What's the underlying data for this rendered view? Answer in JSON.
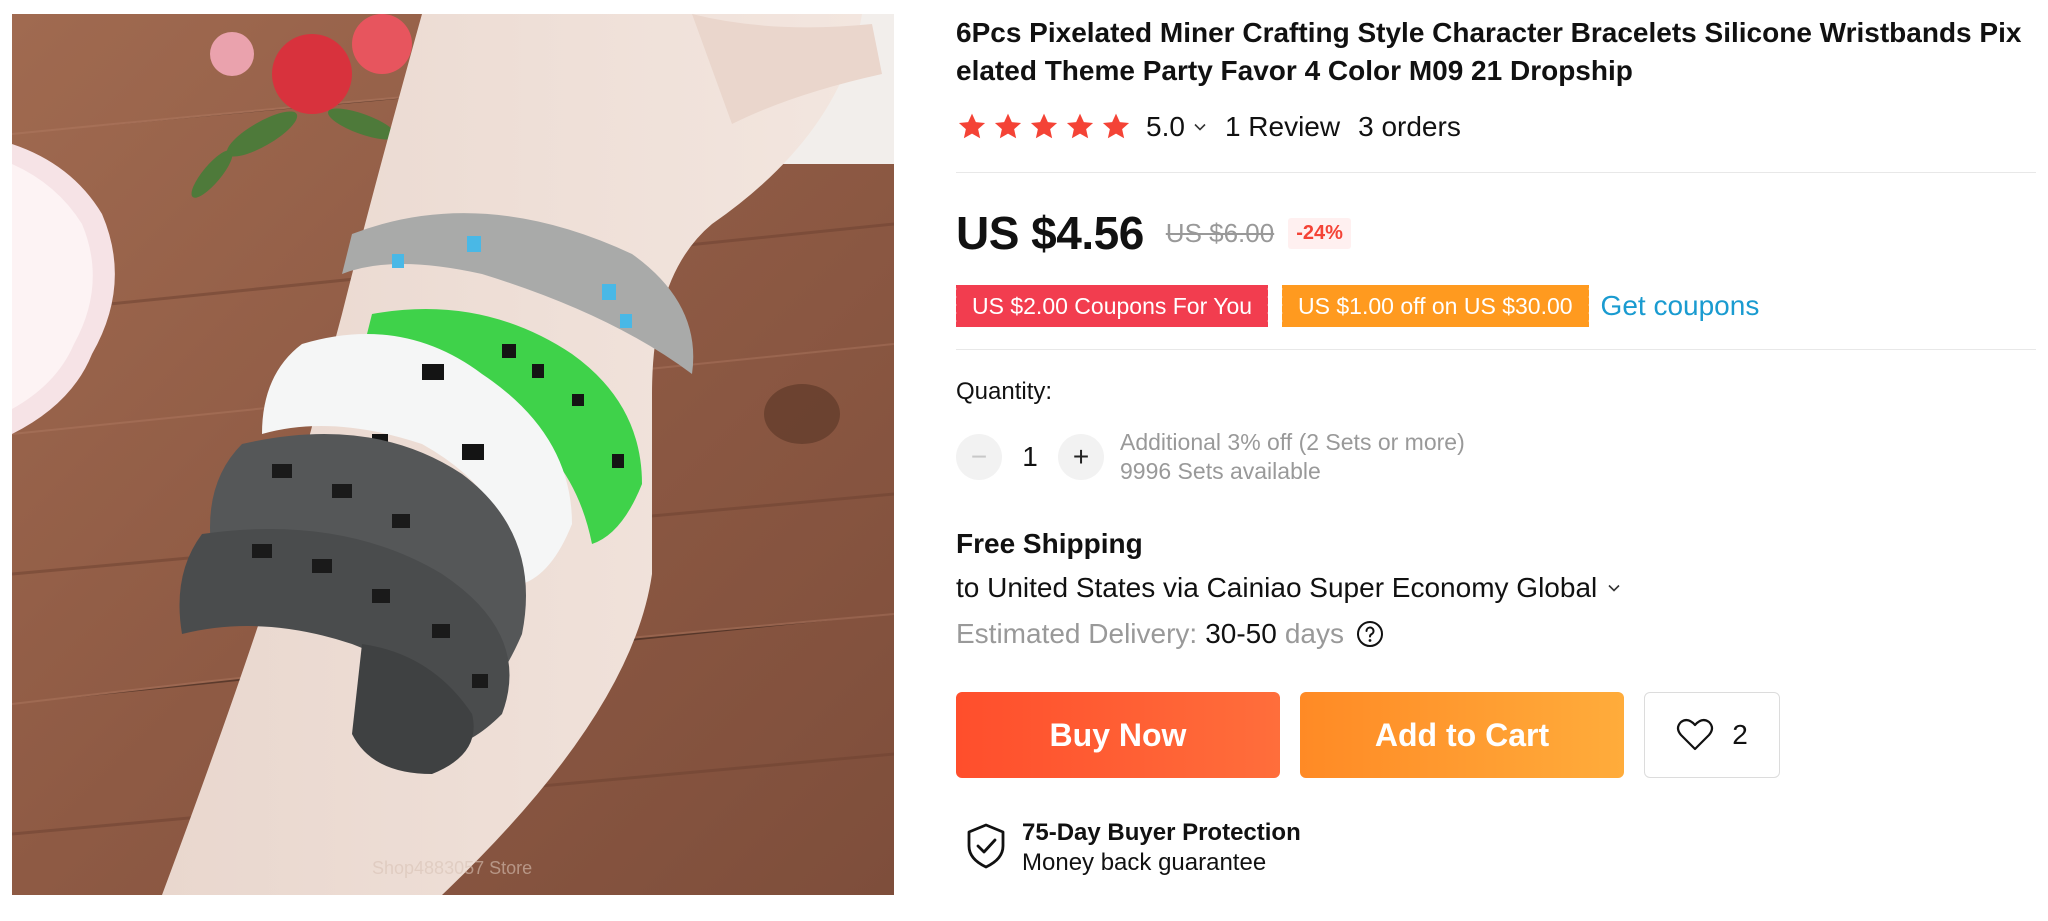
{
  "product": {
    "title": "6Pcs Pixelated Miner Crafting Style Character Bracelets Silicone Wristbands Pixelated Theme Party Favor 4 Color M09 21 Dropship",
    "image_alt": "bracelets-photo",
    "watermark": "Shop4883057 Store"
  },
  "rating": {
    "value": "5.0",
    "stars": 5,
    "reviews": "1 Review",
    "orders": "3 orders",
    "star_color": "#f44336"
  },
  "price": {
    "current": "US $4.56",
    "original": "US $6.00",
    "discount": "-24%"
  },
  "coupons": {
    "items": [
      {
        "label": "US $2.00 Coupons For You",
        "color": "#f23d4f"
      },
      {
        "label": "US $1.00 off on US $30.00",
        "color": "#ff9a1f"
      }
    ],
    "get_label": "Get coupons"
  },
  "quantity": {
    "label": "Quantity:",
    "minus": "−",
    "value": "1",
    "plus": "+",
    "note1": "Additional 3% off (2 Sets or more)",
    "note2": "9996 Sets available"
  },
  "shipping": {
    "title": "Free Shipping",
    "via": "to United States via Cainiao Super Economy Global",
    "delivery_label": "Estimated Delivery:",
    "delivery_value": "30-50",
    "delivery_unit": "days"
  },
  "actions": {
    "buy_now": "Buy Now",
    "add_to_cart": "Add to Cart",
    "wishlist_count": "2"
  },
  "protection": {
    "title": "75-Day Buyer Protection",
    "subtitle": "Money back guarantee"
  },
  "colors": {
    "accent_red": "#ff4e2c",
    "accent_orange": "#ff9a1f",
    "link_blue": "#1a9bd0"
  }
}
